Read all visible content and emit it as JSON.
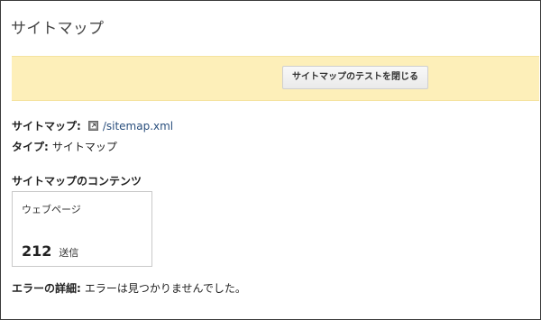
{
  "page": {
    "title": "サイトマップ"
  },
  "banner": {
    "close_test_button": "サイトマップのテストを閉じる"
  },
  "details": {
    "sitemap_label": "サイトマップ:",
    "sitemap_link": "/sitemap.xml",
    "sitemap_link_icon": "external-link-icon",
    "type_label": "タイプ:",
    "type_value": "サイトマップ"
  },
  "contents": {
    "heading": "サイトマップのコンテンツ",
    "card_label": "ウェブページ",
    "count": "212",
    "count_unit": "送信"
  },
  "errors": {
    "label": "エラーの詳細:",
    "value": "エラーは見つかりませんでした。"
  },
  "colors": {
    "banner_bg": "#fdefb9",
    "link": "#2a4f7d"
  }
}
